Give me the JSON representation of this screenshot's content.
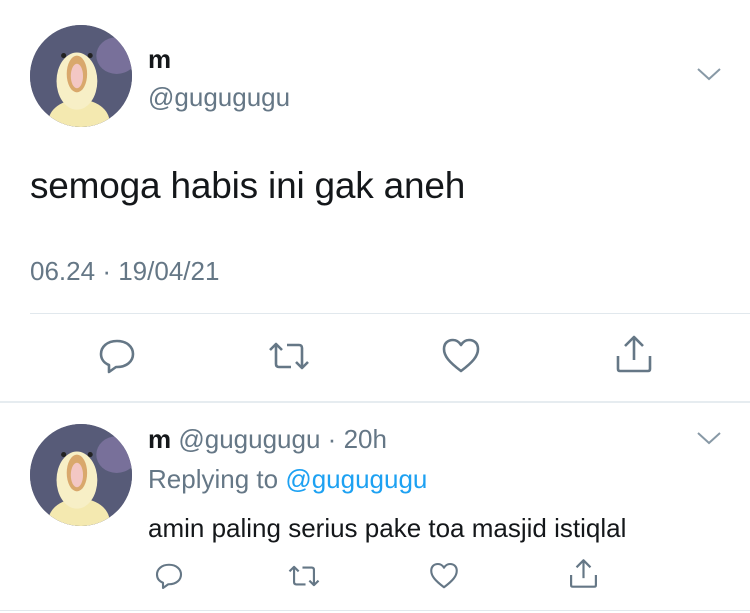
{
  "main_tweet": {
    "name": "m",
    "handle": "@gugugugu",
    "text": "semoga habis ini gak aneh",
    "time": "06.24",
    "separator": "·",
    "date": "19/04/21"
  },
  "reply_tweet": {
    "name": "m",
    "handle": "@gugugugu",
    "separator": "·",
    "time_ago": "20h",
    "replying_label": "Replying to",
    "replying_to": "@gugugugu",
    "text": "amin paling serius pake toa masjid istiqlal"
  },
  "icons": {
    "reply": "speech-bubble-icon",
    "retweet": "retweet-icon",
    "like": "heart-icon",
    "share": "share-icon",
    "menu": "chevron-down-icon"
  },
  "colors": {
    "text": "#14171a",
    "secondary": "#657786",
    "link": "#1da1f2",
    "divider": "#e1e8ed"
  }
}
